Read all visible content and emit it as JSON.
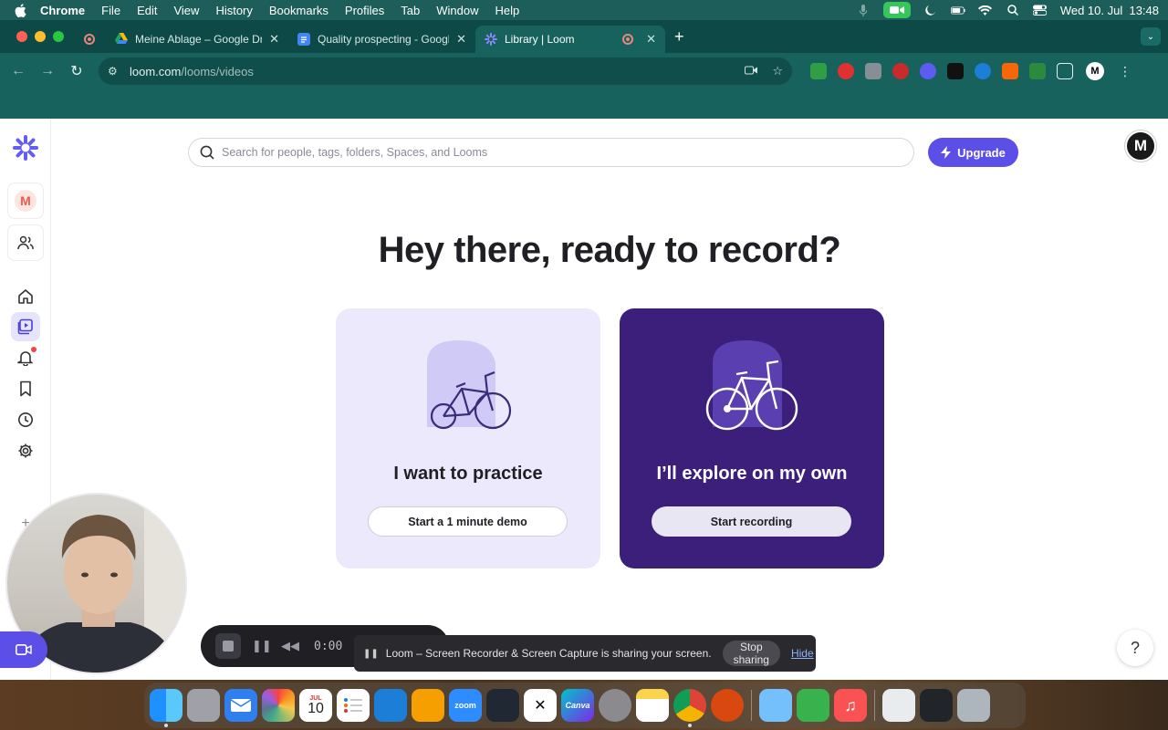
{
  "menubar": {
    "app": "Chrome",
    "items": [
      "File",
      "Edit",
      "View",
      "History",
      "Bookmarks",
      "Profiles",
      "Tab",
      "Window",
      "Help"
    ],
    "clock": "Wed 10. Jul  13:48"
  },
  "browser": {
    "tabs": [
      {
        "title": "Meine Ablage – Google Drive",
        "favicon_color": "#1fa463"
      },
      {
        "title": "Quality prospecting - Google",
        "favicon_color": "#4285f4"
      },
      {
        "title": "Library | Loom",
        "favicon_color": "#625df5",
        "active": true
      }
    ],
    "url_host": "loom.com",
    "url_path": "/looms/videos"
  },
  "app": {
    "search_placeholder": "Search for people, tags, folders, Spaces, and Looms",
    "upgrade_label": "Upgrade",
    "workspace_initial": "M",
    "user_initial": "M",
    "brand_color": "#625df5",
    "headline": "Hey there, ready to record?",
    "cards": [
      {
        "title": "I want to practice",
        "button": "Start a 1 minute demo"
      },
      {
        "title": "I’ll explore on my own",
        "button": "Start recording"
      }
    ],
    "help_label": "?"
  },
  "recorder": {
    "time": "0:00"
  },
  "sharebar": {
    "message": "Loom – Screen Recorder & Screen Capture is sharing your screen.",
    "stop_label": "Stop sharing",
    "hide_label": "Hide"
  },
  "dock": {
    "calendar_month": "JUL",
    "calendar_day": "10",
    "zoom_label": "zoom",
    "canva_label": "Canva"
  }
}
